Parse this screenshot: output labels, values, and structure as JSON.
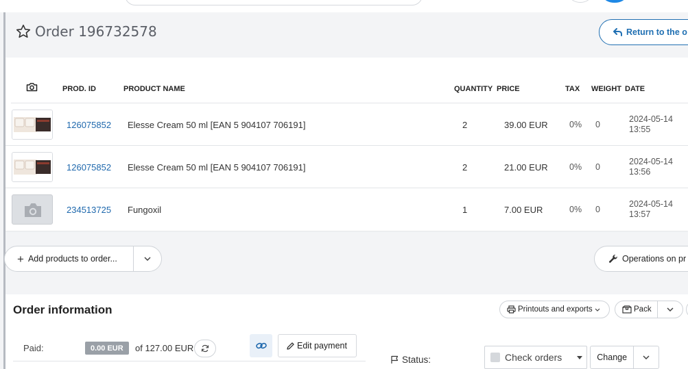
{
  "header": {
    "order_title": "Order 196732578",
    "return_label": "Return to the o"
  },
  "products": {
    "columns": {
      "photo_icon": "camera-icon",
      "prod_id": "PROD. ID",
      "product_name": "PRODUCT NAME",
      "quantity": "QUANTITY",
      "price": "PRICE",
      "tax": "TAX",
      "weight": "WEIGHT",
      "date": "DATE"
    },
    "rows": [
      {
        "prod_id": "126075852",
        "name": "Elesse Cream 50 ml [EAN 5 904107 706191]",
        "quantity": "2",
        "price": "39.00 EUR",
        "tax": "0%",
        "weight": "0",
        "date": "2024-05-14 13:55"
      },
      {
        "prod_id": "126075852",
        "name": "Elesse Cream 50 ml [EAN 5 904107 706191]",
        "quantity": "2",
        "price": "21.00 EUR",
        "tax": "0%",
        "weight": "0",
        "date": "2024-05-14 13:56"
      },
      {
        "prod_id": "234513725",
        "name": "Fungoxil",
        "quantity": "1",
        "price": "7.00 EUR",
        "tax": "0%",
        "weight": "0",
        "date": "2024-05-14 13:57"
      }
    ]
  },
  "actions": {
    "add_products_label": "Add products to order...",
    "operations_label": "Operations on pr"
  },
  "order_info": {
    "title": "Order information",
    "printouts_label": "Printouts and exports",
    "pack_label": "Pack",
    "paid_label": "Paid:",
    "paid_amount": "0.00 EUR",
    "paid_of": "of 127.00 EUR",
    "edit_payment_label": "Edit payment",
    "status_label": "Status:",
    "status_value": "Check orders",
    "change_label": "Change"
  },
  "colors": {
    "accent": "#1e68ad",
    "page_bg": "#f3f4f6",
    "paid_badge": "#9aa0a7"
  }
}
